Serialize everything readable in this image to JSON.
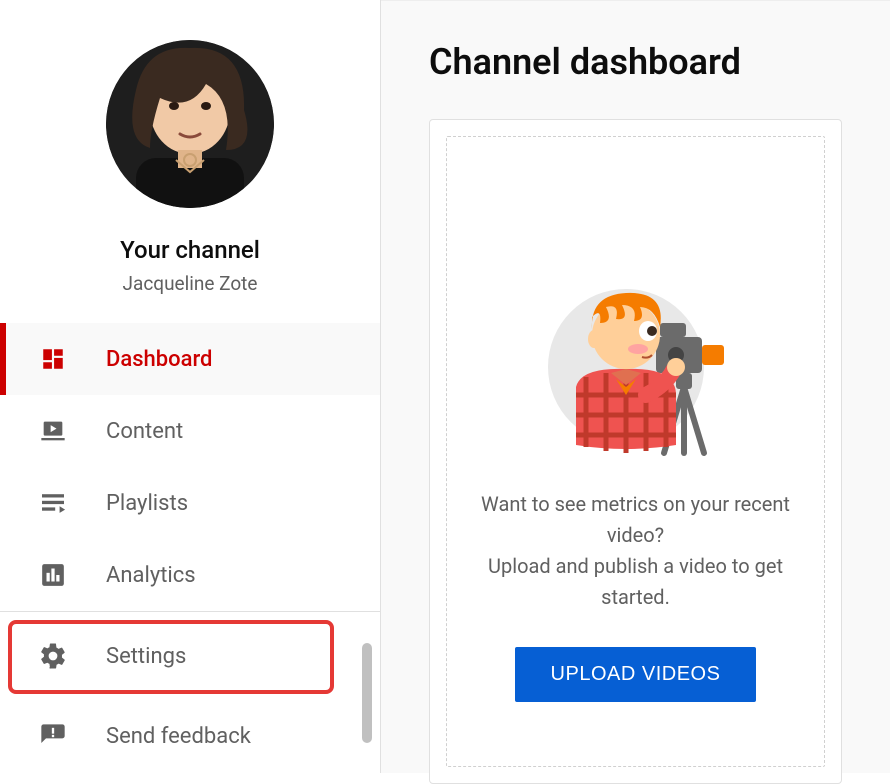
{
  "sidebar": {
    "channel_heading": "Your channel",
    "channel_name": "Jacqueline Zote",
    "items": [
      {
        "label": "Dashboard",
        "icon": "dashboard-icon",
        "active": true
      },
      {
        "label": "Content",
        "icon": "content-icon",
        "active": false
      },
      {
        "label": "Playlists",
        "icon": "playlists-icon",
        "active": false
      },
      {
        "label": "Analytics",
        "icon": "analytics-icon",
        "active": false
      }
    ],
    "footer": [
      {
        "label": "Settings",
        "icon": "gear-icon",
        "highlighted": true
      },
      {
        "label": "Send feedback",
        "icon": "feedback-icon",
        "highlighted": false
      }
    ]
  },
  "main": {
    "title": "Channel dashboard",
    "empty_state": {
      "line1": "Want to see metrics on your recent video?",
      "line2": "Upload and publish a video to get started.",
      "button": "UPLOAD VIDEOS"
    }
  },
  "colors": {
    "accent": "#cc0000",
    "primary_button": "#065fd4",
    "highlight_border": "#e53935"
  }
}
